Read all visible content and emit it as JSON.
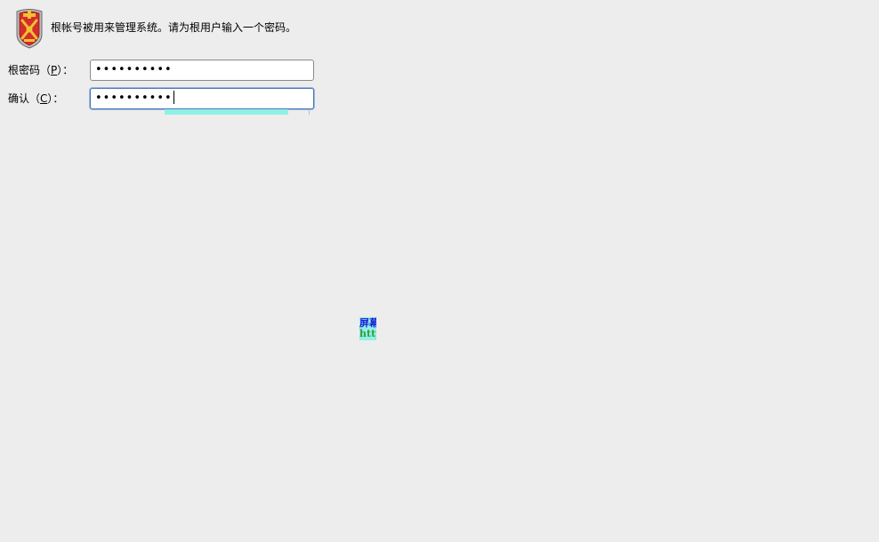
{
  "window": {
    "intro_text": "根帐号被用来管理系统。请为根用户输入一个密码。",
    "icon": "root-shield-icon"
  },
  "form": {
    "password": {
      "label_prefix": "根密码（",
      "mnemonic": "P",
      "label_suffix": "）：",
      "value_masked": "••••••••••"
    },
    "confirm": {
      "label_prefix": "确认（",
      "mnemonic": "C",
      "label_suffix": "）：",
      "value_masked": "••••••••••"
    }
  },
  "watermark": {
    "line1": "屏幕",
    "line2": "http"
  },
  "colors": {
    "background": "#ededed",
    "focus_border": "#4a76b8",
    "shield_red": "#d62c2c",
    "shield_gold": "#f1c232",
    "watermark_bg": "#8ff0e6"
  }
}
